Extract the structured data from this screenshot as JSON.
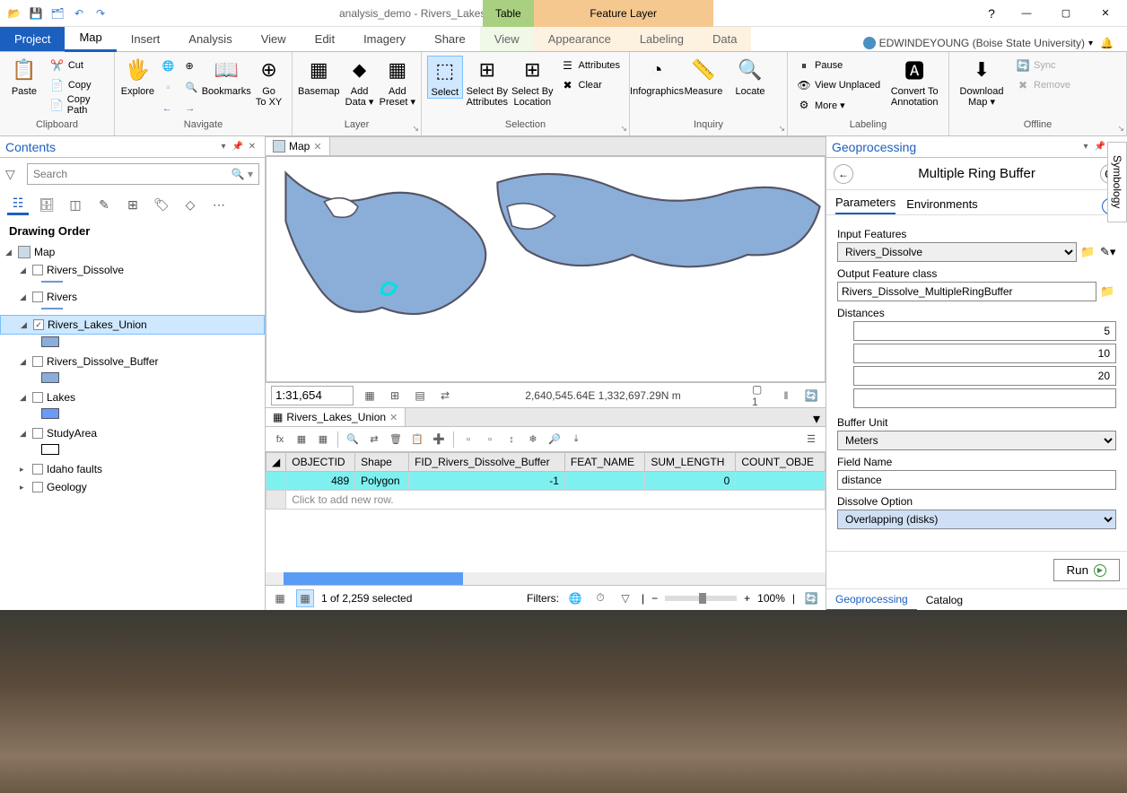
{
  "titlebar": {
    "title": "analysis_demo - Rivers_Lakes_Union - ArcGIS Pro"
  },
  "context_tabs": {
    "table": "Table",
    "table_sub": "View",
    "feature": "Feature Layer"
  },
  "window_controls": {
    "help": "?",
    "minimize": "—",
    "maximize": "▢",
    "close": "✕"
  },
  "user": {
    "name": "EDWINDEYOUNG (Boise State University)",
    "dropdown": "▾"
  },
  "ribbon_tabs": {
    "project": "Project",
    "map": "Map",
    "insert": "Insert",
    "analysis": "Analysis",
    "view": "View",
    "edit": "Edit",
    "imagery": "Imagery",
    "share": "Share",
    "appearance": "Appearance",
    "labeling": "Labeling",
    "data": "Data"
  },
  "ribbon": {
    "clipboard": {
      "label": "Clipboard",
      "paste": "Paste",
      "cut": "Cut",
      "copy": "Copy",
      "copypath": "Copy Path"
    },
    "navigate": {
      "label": "Navigate",
      "explore": "Explore",
      "bookmarks": "Bookmarks",
      "gotoxy": "Go\nTo XY"
    },
    "layer": {
      "label": "Layer",
      "basemap": "Basemap",
      "adddata": "Add\nData ▾",
      "addpreset": "Add\nPreset ▾"
    },
    "selection": {
      "label": "Selection",
      "select": "Select",
      "selbyattr": "Select By\nAttributes",
      "selbyloc": "Select By\nLocation",
      "attributes": "Attributes",
      "clear": "Clear"
    },
    "inquiry": {
      "label": "Inquiry",
      "infographics": "Infographics",
      "measure": "Measure",
      "locate": "Locate"
    },
    "labeling": {
      "label": "Labeling",
      "pause": "Pause",
      "viewunplaced": "View Unplaced",
      "more": "More ▾",
      "convert": "Convert To\nAnnotation"
    },
    "offline": {
      "label": "Offline",
      "download": "Download\nMap ▾",
      "sync": "Sync",
      "remove": "Remove"
    }
  },
  "contents": {
    "title": "Contents",
    "search_placeholder": "Search",
    "drawing_order": "Drawing Order",
    "map": "Map",
    "layers": [
      {
        "name": "Rivers_Dissolve",
        "checked": false,
        "sym": "line",
        "color": "#6a9bd0"
      },
      {
        "name": "Rivers",
        "checked": false,
        "sym": "line",
        "color": "#6a9bd0"
      },
      {
        "name": "Rivers_Lakes_Union",
        "checked": true,
        "sym": "rect",
        "color": "#8aaed8",
        "selected": true
      },
      {
        "name": "Rivers_Dissolve_Buffer",
        "checked": false,
        "sym": "rect",
        "color": "#8aaed8"
      },
      {
        "name": "Lakes",
        "checked": false,
        "sym": "rect",
        "color": "#6a9bf5"
      },
      {
        "name": "StudyArea",
        "checked": false,
        "sym": "rect",
        "color": "#ffffff",
        "border": "#000"
      },
      {
        "name": "Idaho faults",
        "checked": false,
        "sym": "none"
      },
      {
        "name": "Geology",
        "checked": false,
        "sym": "none"
      }
    ]
  },
  "map_tab": {
    "name": "Map"
  },
  "map_status": {
    "scale": "1:31,654",
    "coords": "2,640,545.64E 1,332,697.29N m"
  },
  "attr_table": {
    "tab": "Rivers_Lakes_Union",
    "columns": [
      "OBJECTID",
      "Shape",
      "FID_Rivers_Dissolve_Buffer",
      "FEAT_NAME",
      "SUM_LENGTH",
      "COUNT_OBJE"
    ],
    "rows": [
      {
        "OBJECTID": "489",
        "Shape": "Polygon",
        "FID_Rivers_Dissolve_Buffer": "-1",
        "FEAT_NAME": "",
        "SUM_LENGTH": "0",
        "COUNT_OBJE": ""
      }
    ],
    "newrow": "Click to add new row.",
    "status": "1 of 2,259 selected",
    "filters": "Filters:",
    "zoom": "100%"
  },
  "gp": {
    "title": "Geoprocessing",
    "tool": "Multiple Ring Buffer",
    "tab_params": "Parameters",
    "tab_env": "Environments",
    "input_features_label": "Input Features",
    "input_features": "Rivers_Dissolve",
    "output_label": "Output Feature class",
    "output": "Rivers_Dissolve_MultipleRingBuffer",
    "distances_label": "Distances",
    "distances": [
      "5",
      "10",
      "20",
      ""
    ],
    "buffer_unit_label": "Buffer Unit",
    "buffer_unit": "Meters",
    "field_name_label": "Field Name",
    "field_name": "distance",
    "dissolve_label": "Dissolve Option",
    "dissolve": "Overlapping (disks)",
    "run": "Run",
    "bottom_gp": "Geoprocessing",
    "bottom_catalog": "Catalog"
  },
  "symbology": "Symbology"
}
